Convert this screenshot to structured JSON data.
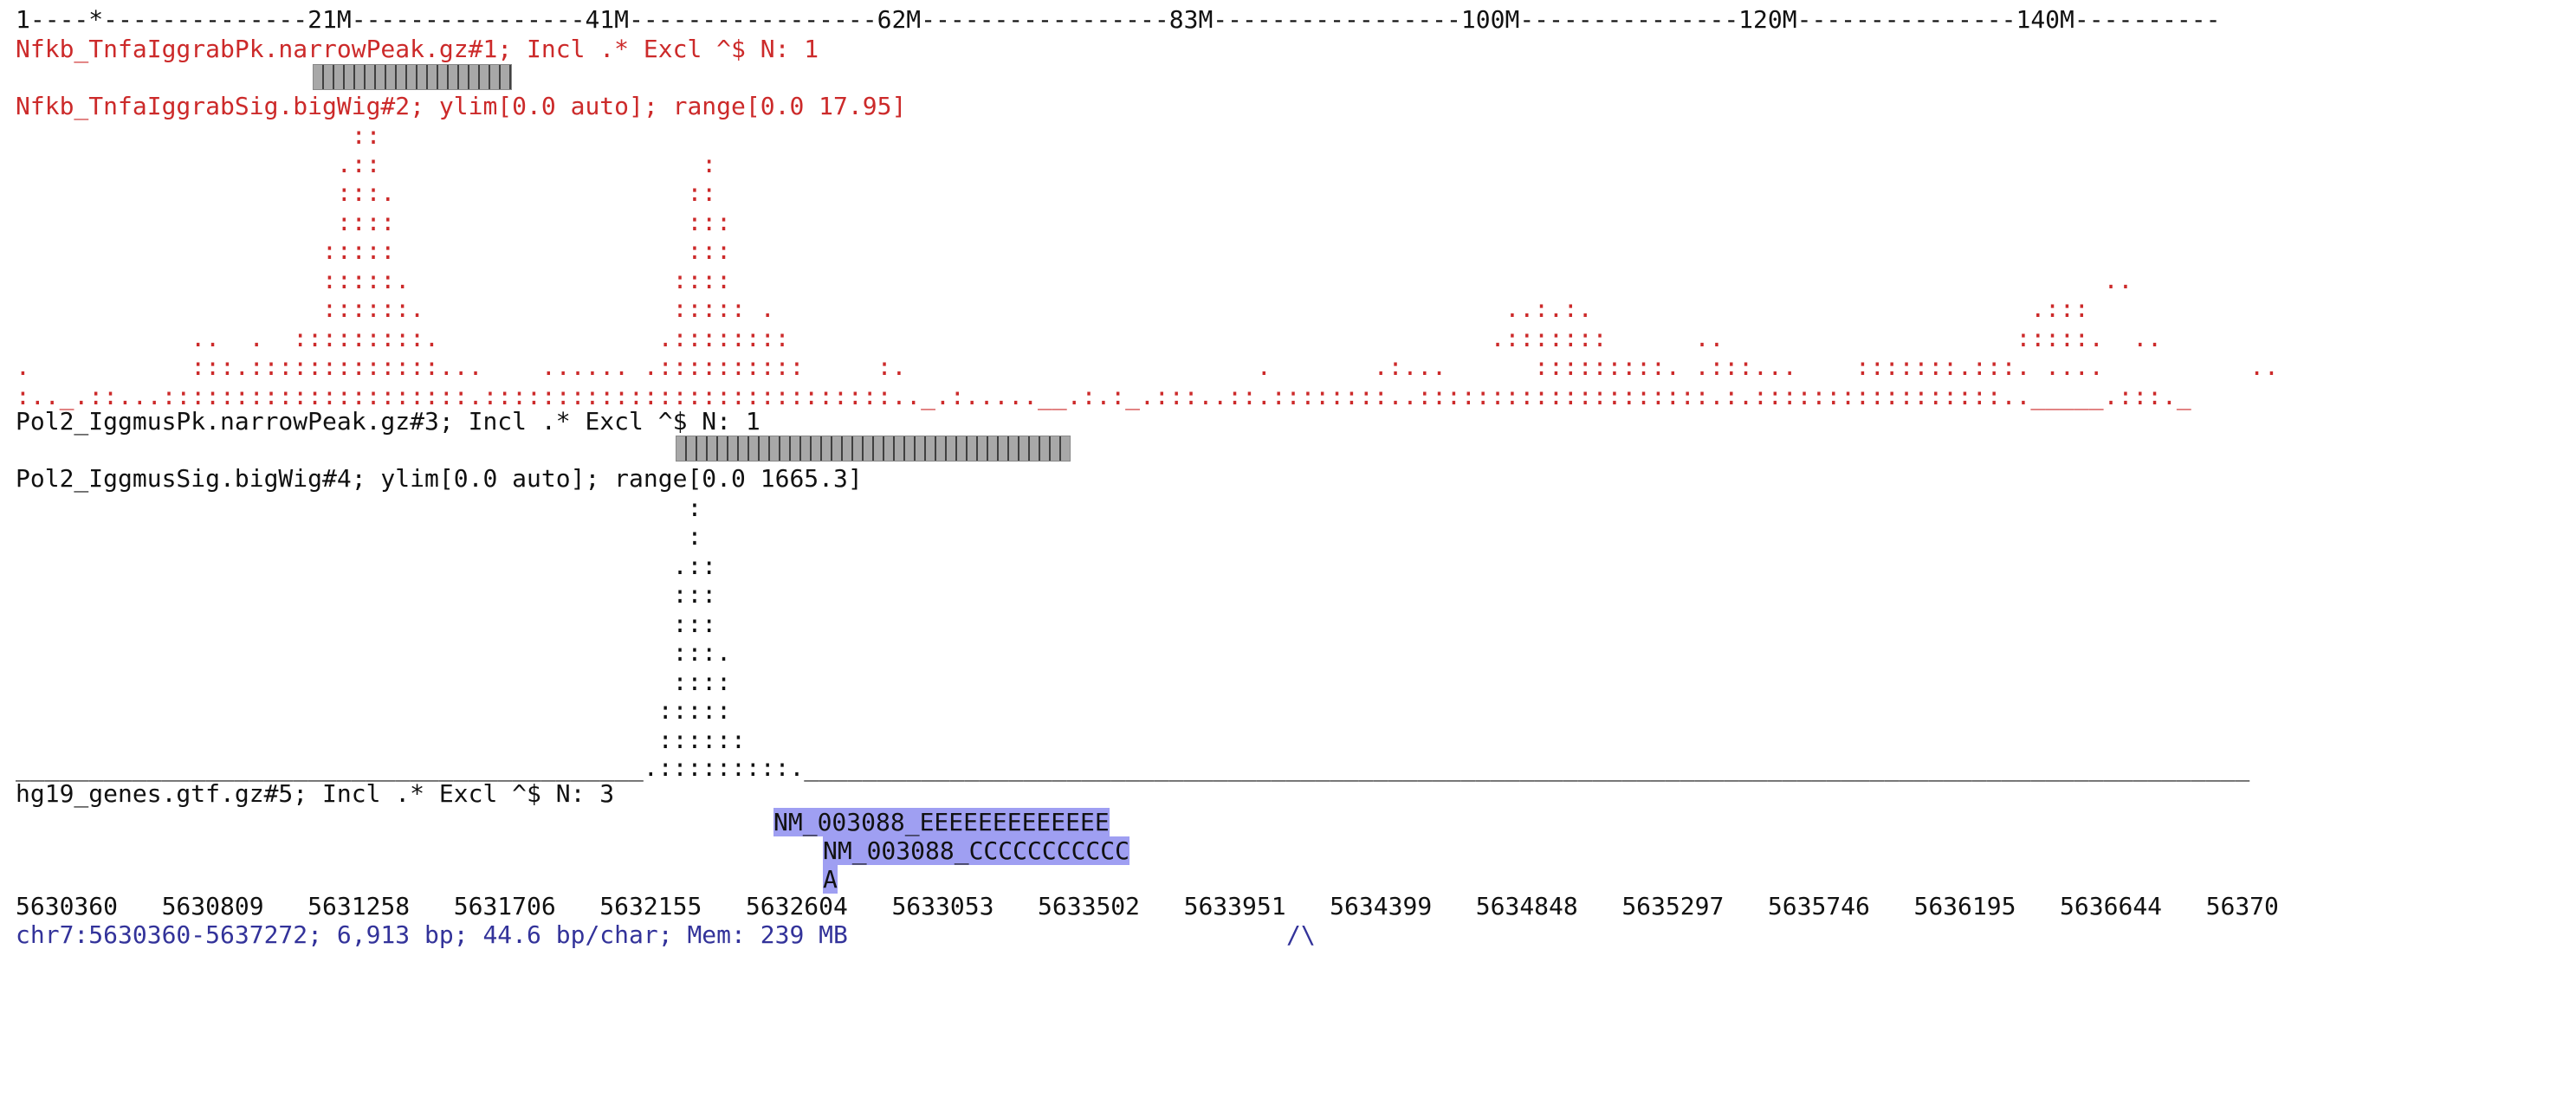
{
  "ruler": "1----*--------------21M----------------41M-----------------62M-----------------83M-----------------100M---------------120M---------------140M----------",
  "tracks": [
    {
      "id": "nfkb_peak",
      "header": "Nfkb_TnfaIggrabPk.narrowPeak.gz#1; Incl .* Excl ^$ N: 1"
    },
    {
      "id": "nfkb_sig",
      "header": "Nfkb_TnfaIggrabSig.bigWig#2; ylim[0.0 auto]; range[0.0 17.95]",
      "rows": [
        "                       ::                                                                                                                                  ",
        "                      .::                      :                                                                                                           ",
        "                      :::.                    ::                                                                                                           ",
        "                      ::::                    :::                                                                                                          ",
        "                     :::::                    :::                                                                                                          ",
        "                     :::::.                  ::::                                                                                              ..         ",
        "                     ::::::.                 ::::: .                                                  ..:.:.                              .:::         ",
        "            ..  .  :::::::::.               .::::::::                                                .:::::::      ..                    :::::.  ..     ",
        ".           :::.:::::::::::::...    ...... .::::::::::     :.                        .       .:...      :::::::::. .:::...    :::::::.:::. ....          ..  ",
        ":.._.::...:::::::::::::::::::::.::::::::::::::::::::::::::::.._.:.....__.:.:_.:::..::.::::::::..::::::::::::::::::::.:.:::::::::::::::::.._____.:::._"
      ]
    },
    {
      "id": "pol2_peak",
      "header": "Pol2_IggmusPk.narrowPeak.gz#3; Incl .* Excl ^$ N: 1"
    },
    {
      "id": "pol2_sig",
      "header": "Pol2_IggmusSig.bigWig#4; ylim[0.0 auto]; range[0.0 1665.3]",
      "rows": [
        "                                              :                                                                                                           ",
        "                                              :                                                                                                           ",
        "                                             .::                                                                                                          ",
        "                                             :::                                                                                                          ",
        "                                             :::                                                                                                          ",
        "                                             :::.                                                                                                         ",
        "                                             ::::                                                                                                         ",
        "                                            :::::                                                                                                         ",
        "                                            ::::::                                                                                                        ",
        "___________________________________________.:::::::::.___________________________________________________________________________________________________"
      ]
    },
    {
      "id": "genes",
      "header": "hg19_genes.gtf.gz#5; Incl .* Excl ^$ N: 3",
      "features": [
        "NM_003088_EEEEEEEEEEEEE",
        "NM_003088_CCCCCCCCCCC",
        "A"
      ]
    }
  ],
  "coords": "5630360   5630809   5631258   5631706   5632155   5632604   5633053   5633502   5633951   5634399   5634848   5635297   5635746   5636195   5636644   56370",
  "status": "chr7:5630360-5637272; 6,913 bp; 44.6 bp/char; Mem: 239 MB",
  "status_marker": "/\\",
  "colors": {
    "track_red": "#cc2a2a",
    "track_black": "#111111",
    "status_blue": "#33339a",
    "peak_gray": "#a8a8a8",
    "gene_fill": "#9f9ff2"
  }
}
